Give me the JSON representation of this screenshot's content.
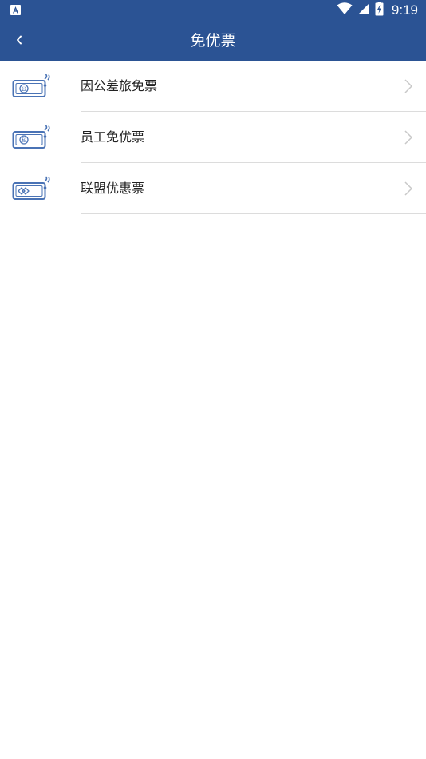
{
  "status_bar": {
    "time": "9:19",
    "bg_color": "#2b5394",
    "app_icon": "a-app-icon",
    "icons": [
      "wifi-icon",
      "signal-icon",
      "battery-charging-icon"
    ]
  },
  "app_bar": {
    "title": "免优票",
    "back_icon": "chevron-left-icon"
  },
  "menu": {
    "items": [
      {
        "label": "因公差旅免票",
        "icon": "ticket-gong-icon",
        "badge_text": "公"
      },
      {
        "label": "员工免优票",
        "icon": "ticket-si-icon",
        "badge_text": "私"
      },
      {
        "label": "联盟优惠票",
        "icon": "ticket-alliance-icon",
        "badge_text": ""
      }
    ],
    "icon_color": "#4a73b5",
    "divider_color": "#dcdcdc",
    "chevron_color": "#c8c8c8"
  }
}
